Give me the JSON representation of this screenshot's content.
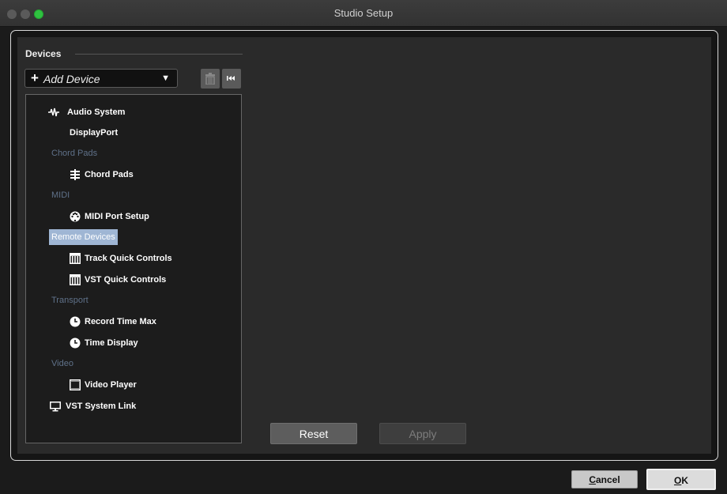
{
  "window": {
    "title": "Studio Setup"
  },
  "devices": {
    "header": "Devices",
    "add_device_label": "Add Device"
  },
  "tree": {
    "items": [
      {
        "label": "Audio System",
        "icon": "audio-waveform-icon",
        "type": "item"
      },
      {
        "label": "DisplayPort",
        "icon": "",
        "type": "item"
      },
      {
        "label": "Chord Pads",
        "type": "category"
      },
      {
        "label": "Chord Pads",
        "icon": "chord-pads-icon",
        "type": "item"
      },
      {
        "label": "MIDI",
        "type": "category"
      },
      {
        "label": "MIDI Port Setup",
        "icon": "midi-port-icon",
        "type": "item"
      },
      {
        "label": "Remote Devices",
        "type": "category",
        "selected": true
      },
      {
        "label": "Track Quick Controls",
        "icon": "keyboard-icon",
        "type": "item"
      },
      {
        "label": "VST Quick Controls",
        "icon": "keyboard-icon",
        "type": "item"
      },
      {
        "label": "Transport",
        "type": "category"
      },
      {
        "label": "Record Time Max",
        "icon": "clock-icon",
        "type": "item"
      },
      {
        "label": "Time Display",
        "icon": "clock-icon",
        "type": "item"
      },
      {
        "label": "Video",
        "type": "category"
      },
      {
        "label": "Video Player",
        "icon": "film-frame-icon",
        "type": "item"
      },
      {
        "label": "VST System Link",
        "icon": "monitor-icon",
        "type": "item"
      }
    ]
  },
  "buttons": {
    "reset": "Reset",
    "apply": "Apply",
    "cancel_first": "C",
    "cancel_rest": "ancel",
    "ok_first": "O",
    "ok_rest": "K"
  },
  "colors": {
    "selection": "#9fb6d4",
    "category_text": "#5f7189",
    "maximize_button": "#2fc140"
  }
}
